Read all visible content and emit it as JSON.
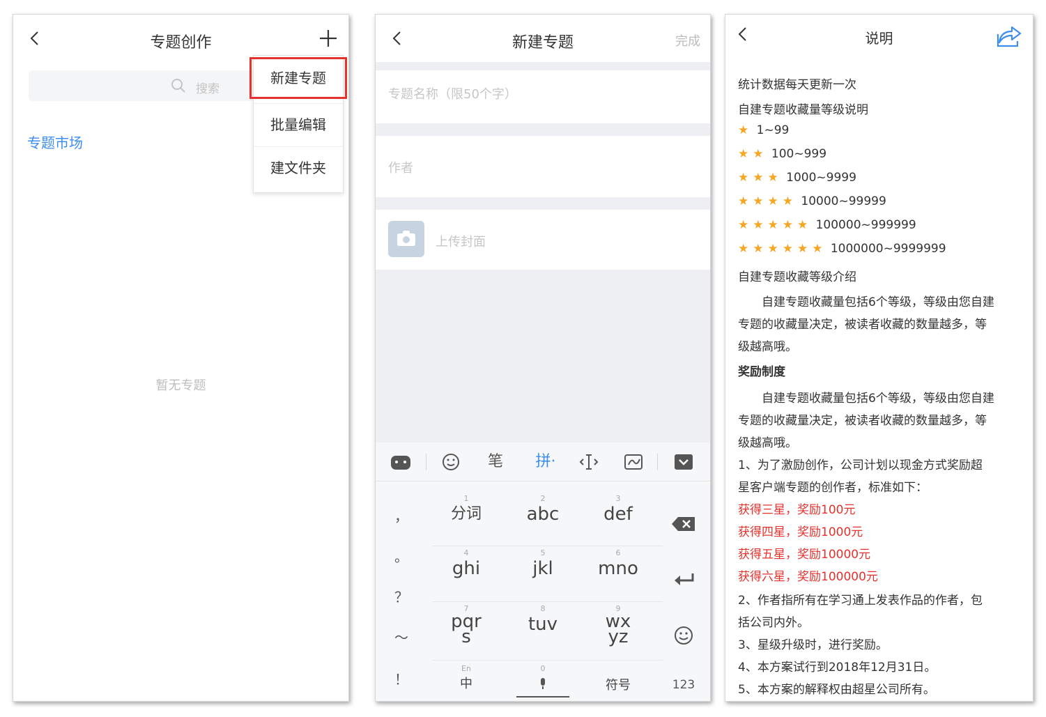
{
  "colors": {
    "accent": "#3d8eec",
    "highlight": "#e5322d",
    "star": "#f5a623"
  },
  "panel1": {
    "title": "专题创作",
    "search_placeholder": "搜索",
    "market_link": "专题市场",
    "empty_text": "暂无专题",
    "menu": [
      "新建专题",
      "批量编辑",
      "建文件夹"
    ]
  },
  "panel2": {
    "title": "新建专题",
    "done_label": "完成",
    "name_placeholder": "专题名称（限50个字）",
    "author_placeholder": "作者",
    "cover_label": "上传封面",
    "toolbar": {
      "stroke": "笔",
      "pinyin": "拼·"
    },
    "keys": [
      {
        "num": "1",
        "label": "分词"
      },
      {
        "num": "2",
        "label": "abc"
      },
      {
        "num": "3",
        "label": "def"
      },
      {
        "num": "4",
        "label": "ghi"
      },
      {
        "num": "5",
        "label": "jkl"
      },
      {
        "num": "6",
        "label": "mno"
      },
      {
        "num": "7",
        "label": "pqrs"
      },
      {
        "num": "8",
        "label": "tuv"
      },
      {
        "num": "9",
        "label": "wxyz"
      }
    ],
    "punct": [
      "，",
      "。",
      "？",
      "～",
      "！"
    ],
    "bottom": {
      "zh_num": "En",
      "zh": "中",
      "zero": "0",
      "symbol": "符号",
      "numkey": "123"
    }
  },
  "panel3": {
    "title": "说明",
    "l1": "统计数据每天更新一次",
    "l2": "自建专题收藏量等级说明",
    "levels": [
      "1~99",
      "100~999",
      "1000~9999",
      "10000~99999",
      "100000~999999",
      "1000000~9999999"
    ],
    "l3": "自建专题收藏等级介绍",
    "p1a": "自建专题收藏量包括6个等级，等级由您自建",
    "p1b": "专题的收藏量决定，被读者收藏的数量越多，等",
    "p1c": "级越高哦。",
    "h_reward": "奖励制度",
    "p2a": "自建专题收藏量包括6个等级，等级由您自建",
    "p2b": "专题的收藏量决定，被读者收藏的数量越多，等",
    "p2c": "级越高哦。",
    "r1a": "1、为了激励创作，公司计划以现金方式奖励超",
    "r1b": "星客户端专题的创作者，标准如下：",
    "rw": [
      "获得三星，奖励100元",
      "获得四星，奖励1000元",
      "获得五星，奖励10000元",
      "获得六星，奖励100000元"
    ],
    "r2a": "2、作者指所有在学习通上发表作品的作者，包",
    "r2b": "括公司内外。",
    "r3": "3、星级升级时，进行奖励。",
    "r4": "4、本方案试行到2018年12月31日。",
    "r5": "5、本方案的解释权由超星公司所有。"
  }
}
